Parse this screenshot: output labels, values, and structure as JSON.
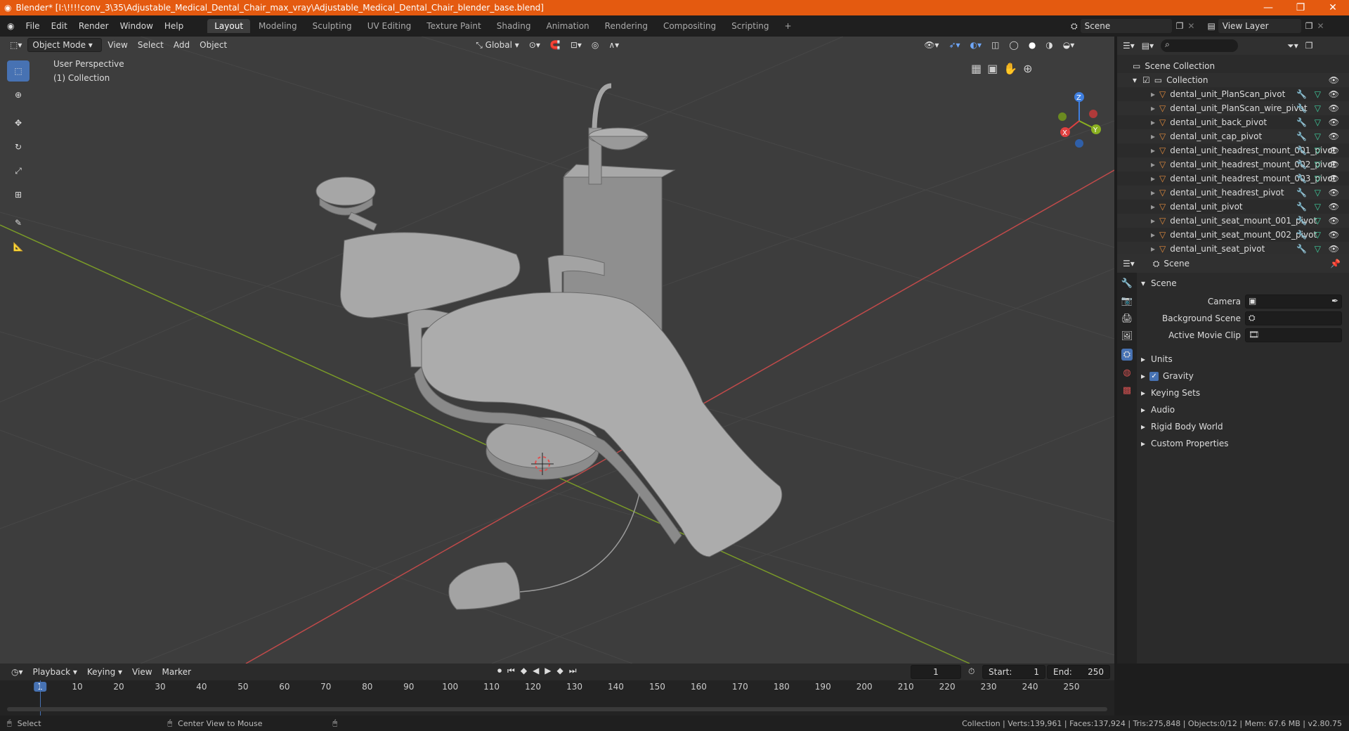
{
  "title": "Blender* [I:\\!!!!conv_3\\35\\Adjustable_Medical_Dental_Chair_max_vray\\Adjustable_Medical_Dental_Chair_blender_base.blend]",
  "menu": [
    "File",
    "Edit",
    "Render",
    "Window",
    "Help"
  ],
  "workspaces": [
    "Layout",
    "Modeling",
    "Sculpting",
    "UV Editing",
    "Texture Paint",
    "Shading",
    "Animation",
    "Rendering",
    "Compositing",
    "Scripting"
  ],
  "active_workspace": "Layout",
  "scene_name": "Scene",
  "view_layer": "View Layer",
  "viewport": {
    "mode": "Object Mode",
    "menus": [
      "View",
      "Select",
      "Add",
      "Object"
    ],
    "transform": "Global",
    "perspective": "User Perspective",
    "collection": "(1) Collection",
    "gizmo": {
      "x": "X",
      "y": "Y",
      "z": "Z"
    }
  },
  "outliner": {
    "root": "Scene Collection",
    "collection": "Collection",
    "items": [
      "dental_unit_PlanScan_pivot",
      "dental_unit_PlanScan_wire_pivot",
      "dental_unit_back_pivot",
      "dental_unit_cap_pivot",
      "dental_unit_headrest_mount_001_pivot",
      "dental_unit_headrest_mount_002_pivot",
      "dental_unit_headrest_mount_003_pivot",
      "dental_unit_headrest_pivot",
      "dental_unit_pivot",
      "dental_unit_seat_mount_001_pivot",
      "dental_unit_seat_mount_002_pivot",
      "dental_unit_seat_pivot"
    ]
  },
  "properties": {
    "header": "Scene",
    "panel": "Scene",
    "camera_label": "Camera",
    "bg_scene_label": "Background Scene",
    "movie_clip_label": "Active Movie Clip",
    "sections": [
      "Units",
      "Gravity",
      "Keying Sets",
      "Audio",
      "Rigid Body World",
      "Custom Properties"
    ]
  },
  "timeline": {
    "menus": [
      "Playback",
      "Keying",
      "View",
      "Marker"
    ],
    "current_frame": "1",
    "start_label": "Start:",
    "start": "1",
    "end_label": "End:",
    "end": "250",
    "ticks": [
      "1",
      "10",
      "20",
      "30",
      "40",
      "50",
      "60",
      "70",
      "80",
      "90",
      "100",
      "110",
      "120",
      "130",
      "140",
      "150",
      "160",
      "170",
      "180",
      "190",
      "200",
      "210",
      "220",
      "230",
      "240",
      "250"
    ]
  },
  "status": {
    "select": "Select",
    "center": "Center View to Mouse",
    "stats": "Collection | Verts:139,961 | Faces:137,924 | Tris:275,848 | Objects:0/12 | Mem: 67.6 MB | v2.80.75"
  },
  "colors": {
    "accent": "#4772b3",
    "titlebar": "#e45a10",
    "x_axis": "#e04040",
    "y_axis": "#8ab020",
    "z_axis": "#3f7fe0"
  }
}
